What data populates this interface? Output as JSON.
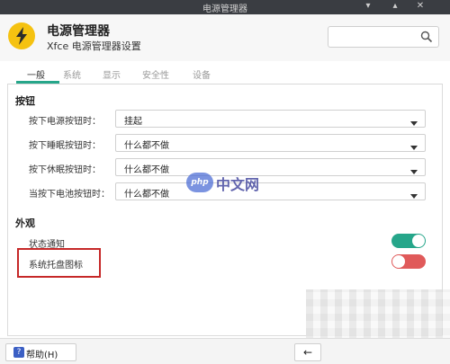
{
  "window": {
    "title": "电源管理器",
    "minimize_icon": "minimize-icon",
    "maximize_icon": "maximize-icon",
    "close_icon": "close-icon"
  },
  "header": {
    "app_title": "电源管理器",
    "app_subtitle": "Xfce 电源管理器设置",
    "app_icon": "lightning-bolt-icon",
    "icon_color": "#f5c211",
    "search": {
      "value": "",
      "placeholder": "",
      "icon": "search-icon"
    }
  },
  "tabs": [
    {
      "label": "一般",
      "active": true
    },
    {
      "label": "系统",
      "active": false
    },
    {
      "label": "显示",
      "active": false
    },
    {
      "label": "安全性",
      "active": false
    },
    {
      "label": "设备",
      "active": false
    }
  ],
  "buttons_section": {
    "title": "按钮",
    "rows": [
      {
        "label": "按下电源按钮时：",
        "value": "挂起"
      },
      {
        "label": "按下睡眠按钮时：",
        "value": "什么都不做"
      },
      {
        "label": "按下休眠按钮时：",
        "value": "什么都不做"
      },
      {
        "label": "当按下电池按钮时：",
        "value": "什么都不做"
      }
    ]
  },
  "appearance_section": {
    "title": "外观",
    "rows": [
      {
        "label": "状态通知",
        "enabled": true,
        "color": "#26a68a"
      },
      {
        "label": "系统托盘图标",
        "enabled": false,
        "color": "#e05a5a"
      }
    ]
  },
  "watermark": {
    "logo_text": "php",
    "text": "中文网"
  },
  "bottom": {
    "help_label": "帮助(H)",
    "help_icon": "help-icon",
    "back_icon": "arrow-left-icon"
  },
  "colors": {
    "accent": "#26a68a",
    "highlight_box": "#c62828"
  }
}
